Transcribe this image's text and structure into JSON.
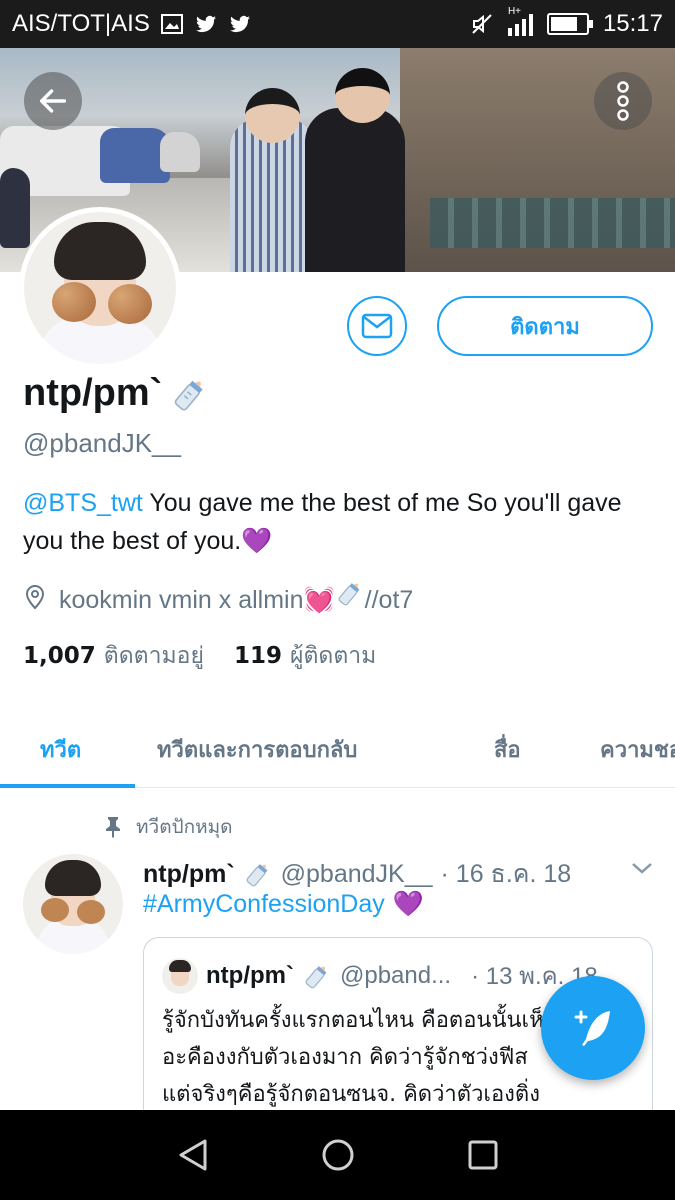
{
  "status_bar": {
    "carrier": "AIS/TOT|AIS",
    "network": "H+",
    "time": "15:17",
    "battery_level_percent": 80
  },
  "profile": {
    "display_name": "ntp/pm`",
    "handle": "@pbandJK__",
    "bio_mention": "@BTS_twt",
    "bio_text": " You gave me the best of me So you'll gave you the best of you.",
    "bio_emoji": "💜",
    "location": "kookmin vmin x allmin",
    "location_emoji": "💓",
    "location_suffix": "//ot7",
    "following_count": "1,007",
    "following_label": "ติดตามอยู่",
    "followers_count": "119",
    "followers_label": "ผู้ติดตาม",
    "follow_button_label": "ติดตาม"
  },
  "tabs": [
    {
      "label": "ทวีต",
      "active": true
    },
    {
      "label": "ทวีตและการตอบกลับ",
      "active": false
    },
    {
      "label": "สื่อ",
      "active": false
    },
    {
      "label": "ความชอบ",
      "active": false
    }
  ],
  "pinned_label": "ทวีตปักหมุด",
  "tweet": {
    "name": "ntp/pm`",
    "handle": "@pbandJK__",
    "date": "· 16 ธ.ค. 18",
    "text": "#ArmyConfessionDay",
    "emoji": "💜",
    "quote": {
      "name": "ntp/pm`",
      "handle": "@pband...",
      "date": "· 13 พ.ค. 18",
      "lines": [
        "รู้จักบังทันครั้งแรกตอนไหน คือตอนนั้นเห็น",
        "อะคืองงกับตัวเองมาก คิดว่ารู้จักชว่งฟีส",
        "แต่จริงๆคือรู้จักตอนซนจ. คิดว่าตัวเองติ่ง"
      ]
    }
  },
  "colors": {
    "accent": "#1da1f2",
    "muted": "#657786",
    "text": "#14171a"
  }
}
